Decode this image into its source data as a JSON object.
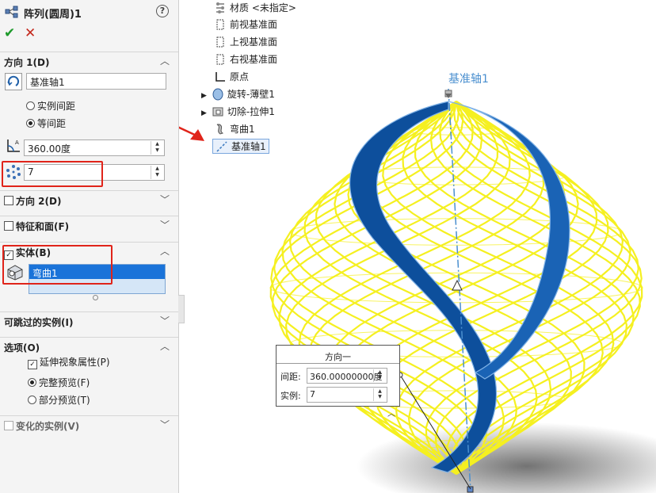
{
  "pm": {
    "title": "阵列(圆周)1",
    "help": "?",
    "ok": "✔",
    "cancel": "✕"
  },
  "direction1": {
    "header": "方向 1(D)",
    "axis_value": "基准轴1",
    "opt_instance_spacing": "实例间距",
    "opt_equal_spacing": "等间距",
    "angle_value": "360.00度",
    "count_value": "7"
  },
  "direction2": {
    "header": "方向 2(D)"
  },
  "features_faces": {
    "header": "特征和面(F)"
  },
  "bodies": {
    "header": "实体(B)",
    "selected_body": "弯曲1"
  },
  "skippable": {
    "header": "可跳过的实例(I)"
  },
  "options": {
    "header": "选项(O)",
    "propagate": "延伸视象属性(P)",
    "full_preview": "完整预览(F)",
    "partial_preview": "部分预览(T)"
  },
  "varied": {
    "header": "变化的实例(V)"
  },
  "tree": {
    "material": "材质 <未指定>",
    "front_plane": "前视基准面",
    "top_plane": "上视基准面",
    "right_plane": "右视基准面",
    "origin": "原点",
    "revolve_thin": "旋转-薄壁1",
    "cut_extrude": "切除-拉伸1",
    "flex": "弯曲1",
    "axis": "基准轴1"
  },
  "viewport": {
    "axis_label": "基准轴1",
    "callout_title": "方向一",
    "spacing_label": "间距:",
    "spacing_value": "360.00000000度",
    "instances_label": "实例:",
    "instances_value": "7"
  },
  "colors": {
    "accent_blue": "#1a73d9",
    "body_blue": "#0d4f9c",
    "preview_yellow": "#f5f020",
    "highlight_red": "#e0241a",
    "axis_blue": "#4a8fcf"
  }
}
